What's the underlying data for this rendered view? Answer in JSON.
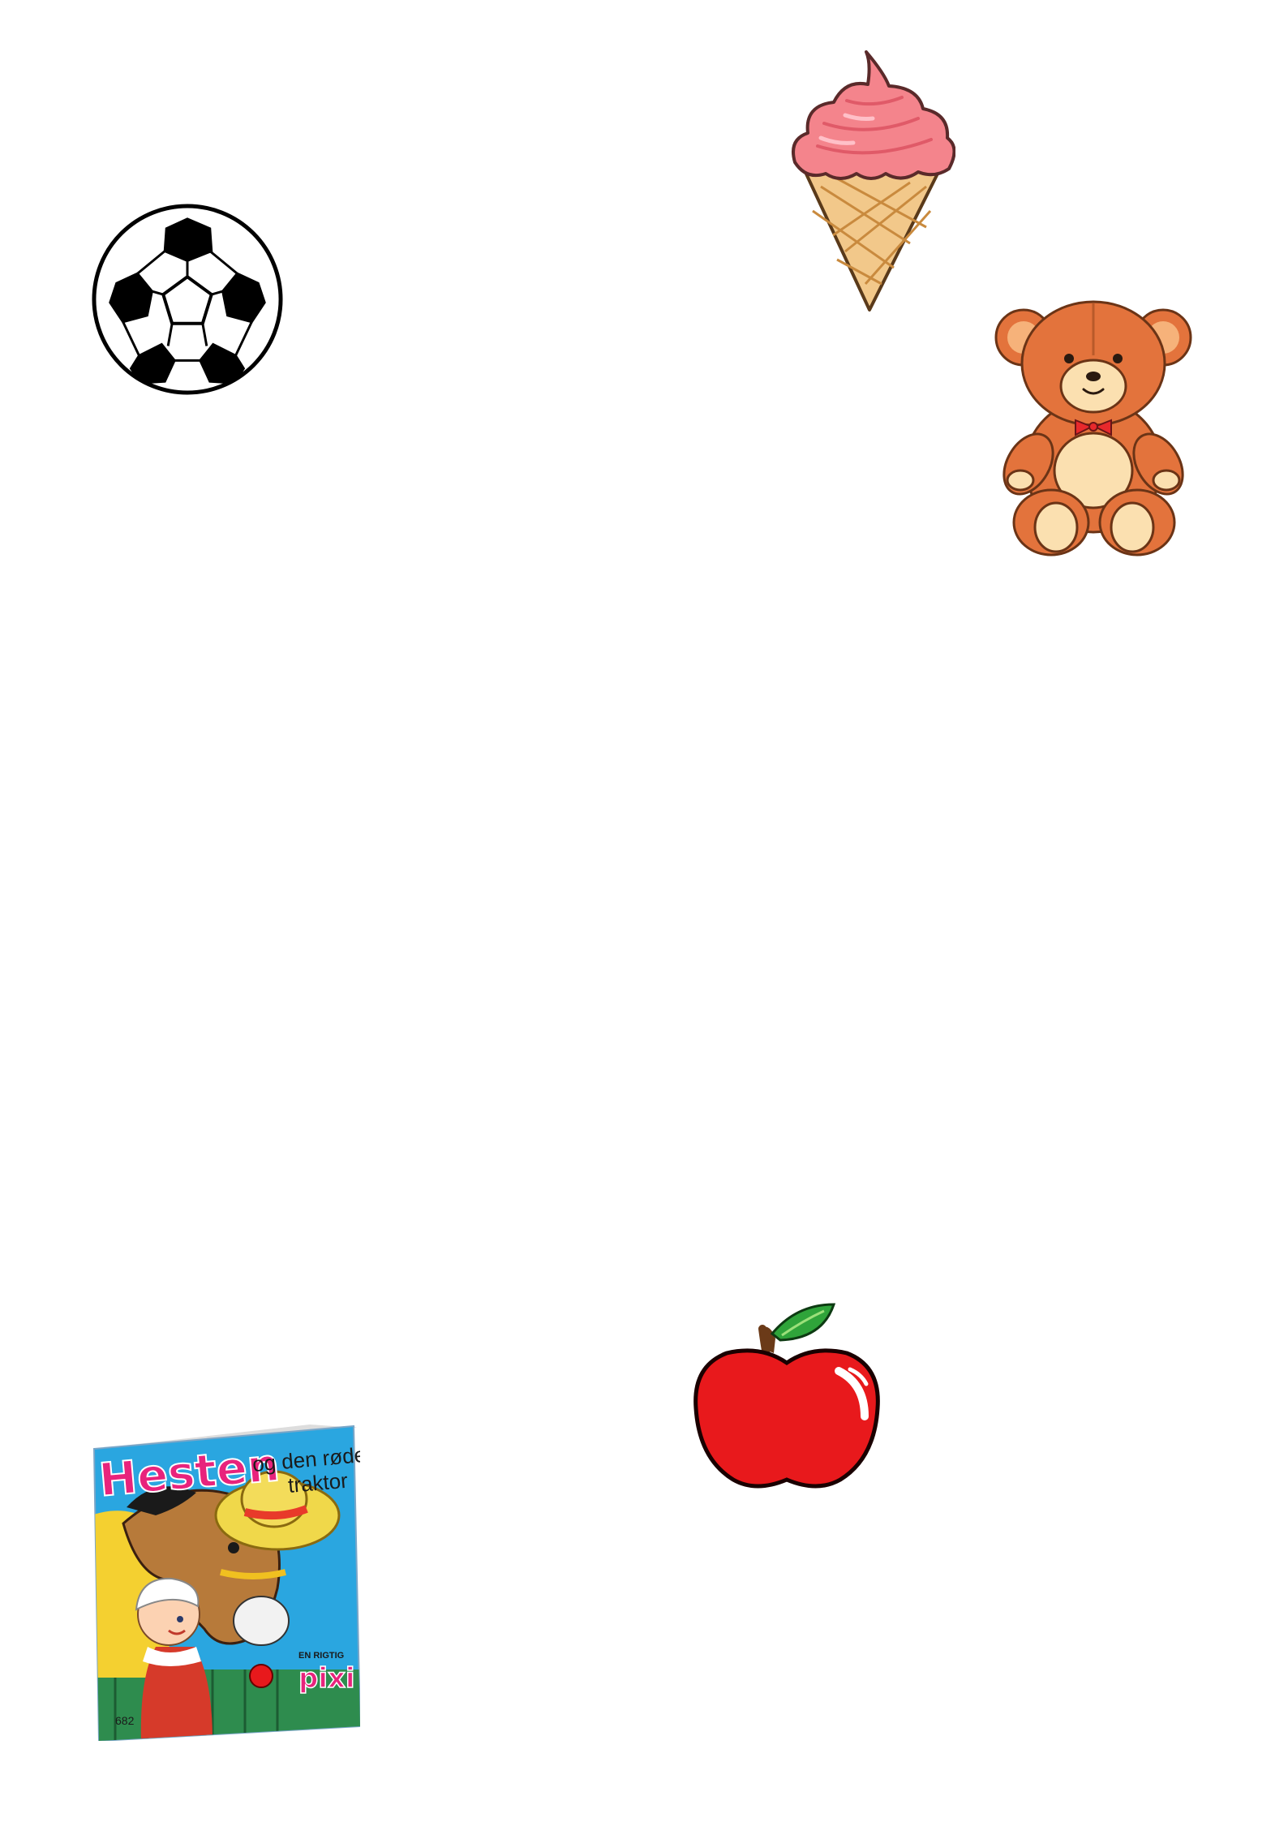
{
  "items": [
    {
      "name": "soccer-ball",
      "icon": "soccer-ball-icon"
    },
    {
      "name": "ice-cream-cone",
      "icon": "ice-cream-icon"
    },
    {
      "name": "teddy-bear",
      "icon": "teddy-bear-icon"
    },
    {
      "name": "red-apple",
      "icon": "apple-icon"
    },
    {
      "name": "pixi-book",
      "icon": "book-icon"
    }
  ],
  "book": {
    "title": "Hesten",
    "subtitle_line1": "og den røde",
    "subtitle_line2": "traktor",
    "series_tag": "EN RIGTIG",
    "series_logo": "pixi",
    "number": "682"
  },
  "colors": {
    "background": "#ffffff",
    "ice_cream_pink": "#f4848c",
    "cone": "#f2c88a",
    "bear": "#e3733c",
    "bear_light": "#fbe0b0",
    "apple": "#e8191c",
    "leaf": "#2fa43a",
    "book_sky": "#2aa6e0",
    "book_title": "#e8237c"
  }
}
